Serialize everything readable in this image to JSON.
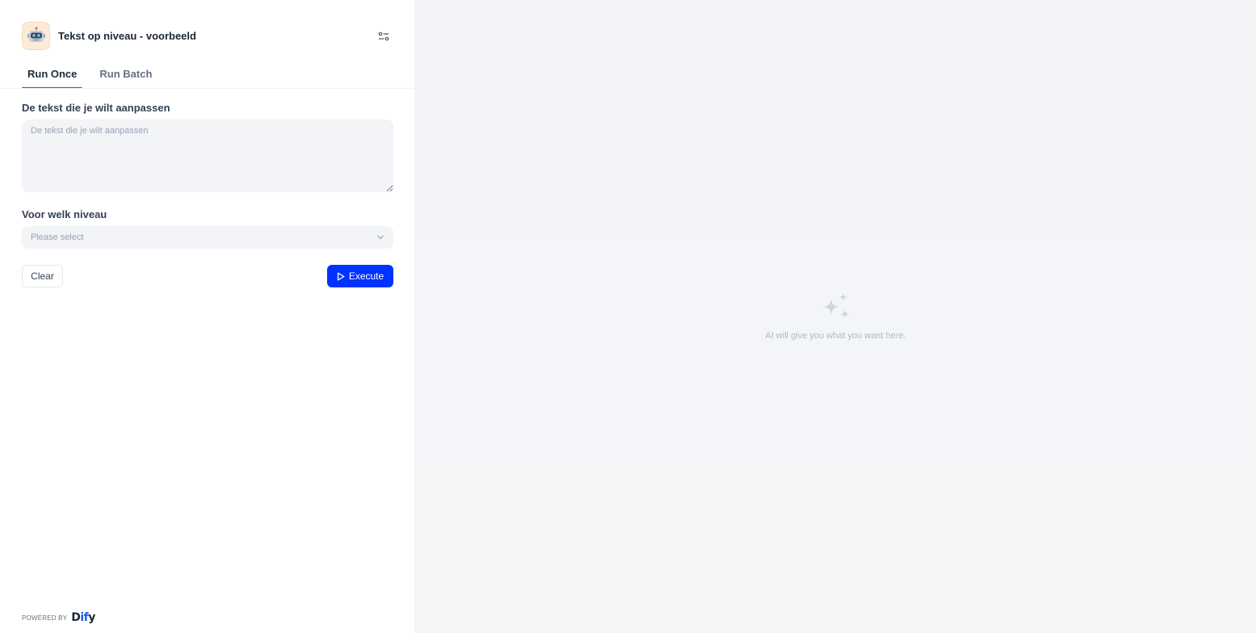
{
  "app": {
    "title": "Tekst op niveau - voorbeeld",
    "icon": "robot-icon"
  },
  "tabs": [
    {
      "label": "Run Once",
      "active": true
    },
    {
      "label": "Run Batch",
      "active": false
    }
  ],
  "form": {
    "text_field": {
      "label": "De tekst die je wilt aanpassen",
      "placeholder": "De tekst die je wilt aanpassen",
      "value": ""
    },
    "level_field": {
      "label": "Voor welk niveau",
      "placeholder": "Please select",
      "value": ""
    },
    "clear_label": "Clear",
    "execute_label": "Execute"
  },
  "footer": {
    "powered_by": "POWERED BY",
    "brand_prefix": "D",
    "brand_mid": "if",
    "brand_suffix": "y"
  },
  "result": {
    "empty_message": "AI will give you what you want here.",
    "icon": "sparkles-icon"
  },
  "colors": {
    "accent": "#0033ff",
    "tab_underline": "#155eef",
    "icon_bg": "#fdebd9"
  }
}
